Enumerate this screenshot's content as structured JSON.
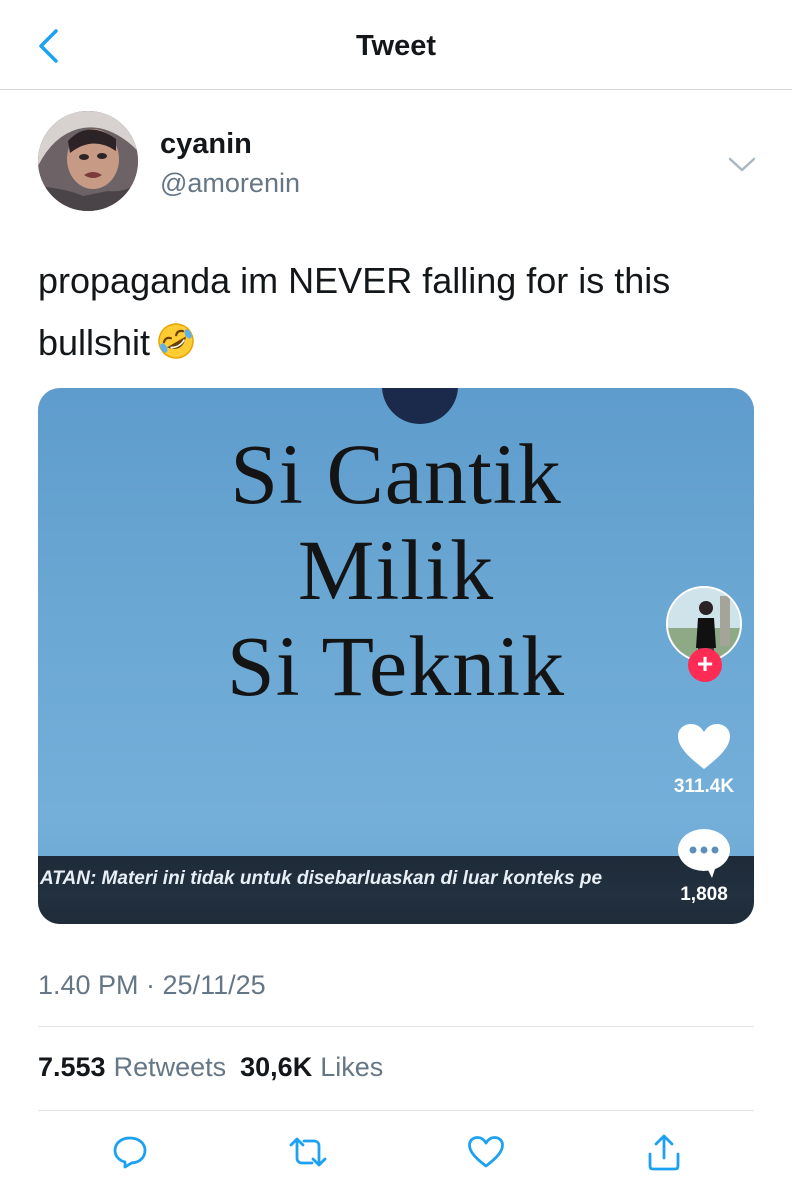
{
  "header": {
    "title": "Tweet"
  },
  "author": {
    "display_name": "cyanin",
    "handle": "@amorenin"
  },
  "tweet": {
    "text": "propaganda im NEVER falling for is this bullshit",
    "emoji": "rolling-on-floor-laughing-emoji",
    "timestamp": "1.40 PM · 25/11/25"
  },
  "media": {
    "headline": [
      "Si Cantik",
      "Milik",
      "Si Teknik"
    ],
    "caption": "ATAN: Materi ini tidak untuk disebarluaskan di luar konteks pe",
    "like_count": "311.4K",
    "comment_count": "1,808",
    "follow_symbol": "+",
    "colors": {
      "sky": "#6aa7d3",
      "follow": "#fe2c55"
    }
  },
  "stats": {
    "retweets_count": "7.553",
    "retweets_label": "Retweets",
    "likes_count": "30,6K",
    "likes_label": "Likes"
  },
  "actions": [
    "reply-icon",
    "retweet-icon",
    "like-icon",
    "share-icon"
  ],
  "colors": {
    "accent": "#1da1f2",
    "text": "#14171a",
    "secondary": "#657786"
  }
}
